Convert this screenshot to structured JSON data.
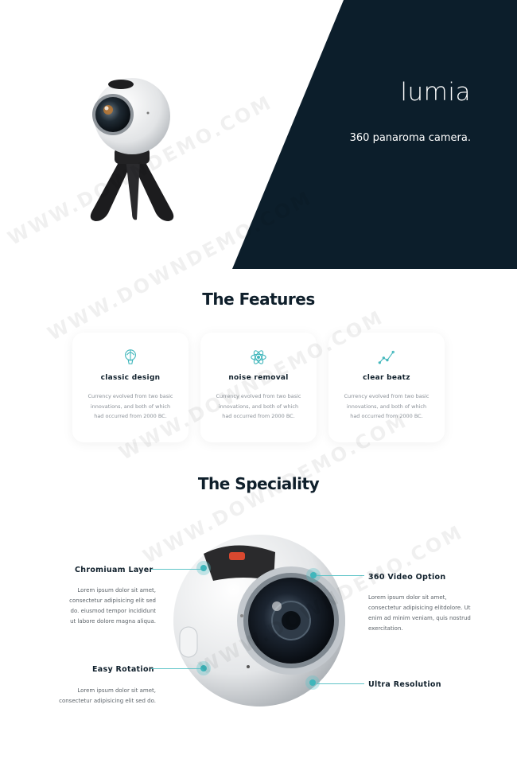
{
  "hero": {
    "brand": "lumia",
    "tagline": "360 panaroma camera.",
    "colors": {
      "dark_panel": "#0c1e2b"
    }
  },
  "features": {
    "title": "The Features",
    "cards": [
      {
        "icon": "balloon-icon",
        "title": "classic design",
        "description": "Currency evolved from two basic innovations, and both of which had occurred from 2000 BC."
      },
      {
        "icon": "atom-icon",
        "title": "noise removal",
        "description": "Currency evolved from two basic innovations, and both of which had occurred from 2000 BC."
      },
      {
        "icon": "trend-line-icon",
        "title": "clear beatz",
        "description": "Currency evolved from two basic innovations, and both of which had occurred from 2000 BC."
      }
    ]
  },
  "speciality": {
    "title": "The Speciality",
    "left": [
      {
        "label": "Chromiuam Layer",
        "description": "Lorem ipsum dolor sit amet, consectetur adipisicing elit sed do. eiusmod tempor incididunt ut labore dolore magna aliqua."
      },
      {
        "label": "Easy Rotation",
        "description": "Lorem ipsum dolor sit amet, consectetur adipisicing elit sed do."
      }
    ],
    "right": [
      {
        "label": "360 Video Option",
        "description": "Lorem ipsum dolor sit amet, consectetur adipisicing elitdolore. Ut enim ad minim veniam, quis nostrud exercitation."
      },
      {
        "label": "Ultra Resolution",
        "description": ""
      }
    ],
    "accent": "#3fb6bb"
  },
  "watermark": "WWW.DOWNDEMO.COM"
}
